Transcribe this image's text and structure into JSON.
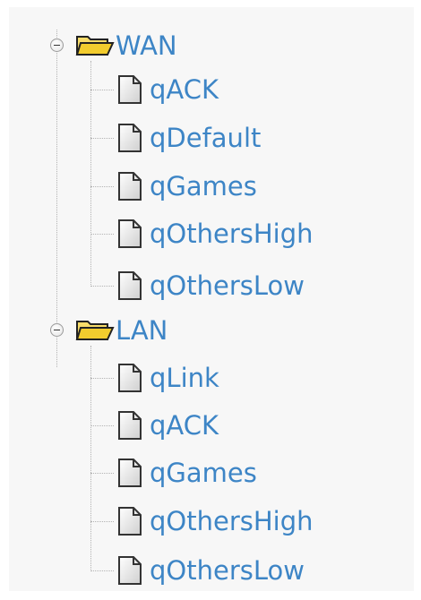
{
  "tree": {
    "groups": [
      {
        "label": "WAN",
        "icon": "folder-open-icon",
        "expanded": true,
        "children": [
          {
            "label": "qACK",
            "icon": "document-icon"
          },
          {
            "label": "qDefault",
            "icon": "document-icon"
          },
          {
            "label": "qGames",
            "icon": "document-icon"
          },
          {
            "label": "qOthersHigh",
            "icon": "document-icon"
          },
          {
            "label": "qOthersLow",
            "icon": "document-icon"
          }
        ]
      },
      {
        "label": "LAN",
        "icon": "folder-open-icon",
        "expanded": true,
        "children": [
          {
            "label": "qLink",
            "icon": "document-icon"
          },
          {
            "label": "qACK",
            "icon": "document-icon"
          },
          {
            "label": "qGames",
            "icon": "document-icon"
          },
          {
            "label": "qOthersHigh",
            "icon": "document-icon"
          },
          {
            "label": "qOthersLow",
            "icon": "document-icon"
          }
        ]
      }
    ],
    "colors": {
      "label": "#3d85c6",
      "panel_background": "#f7f7f7",
      "connector": "#b3b3b3",
      "folder": "#f2cc2e"
    }
  }
}
